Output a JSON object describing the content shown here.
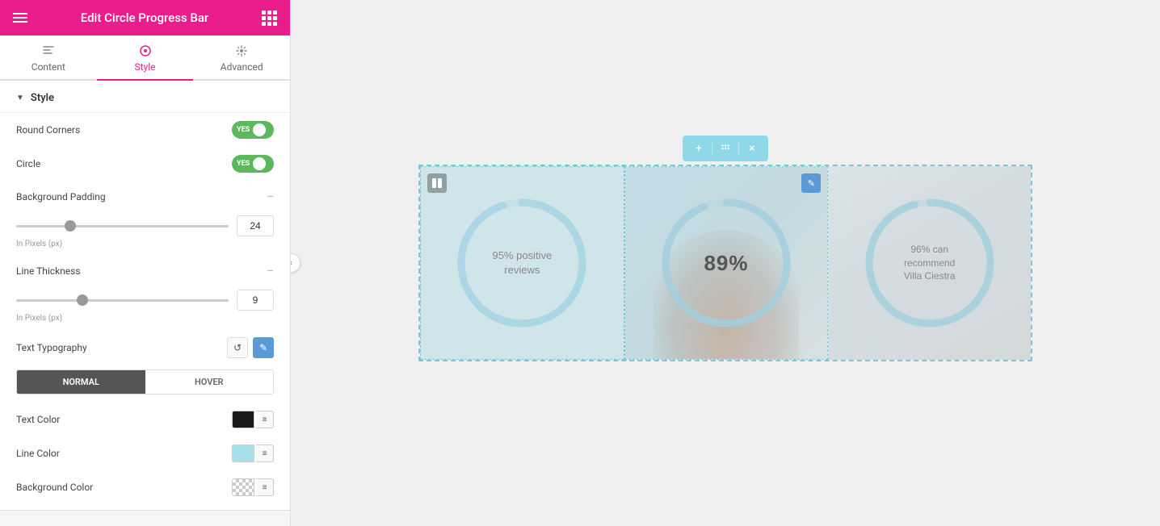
{
  "header": {
    "title": "Edit Circle Progress Bar",
    "hamburger_icon": "hamburger-icon",
    "grid_icon": "grid-icon"
  },
  "tabs": [
    {
      "id": "content",
      "label": "Content",
      "active": false
    },
    {
      "id": "style",
      "label": "Style",
      "active": true
    },
    {
      "id": "advanced",
      "label": "Advanced",
      "active": false
    }
  ],
  "section": {
    "label": "Style"
  },
  "controls": {
    "round_corners": {
      "label": "Round Corners",
      "value": true,
      "toggle_yes": "YES"
    },
    "circle": {
      "label": "Circle",
      "value": true,
      "toggle_yes": "YES"
    },
    "background_padding": {
      "label": "Background Padding",
      "value": 24,
      "unit": "In Pixels (px)"
    },
    "line_thickness": {
      "label": "Line Thickness",
      "value": 9,
      "unit": "In Pixels (px)"
    },
    "text_typography": {
      "label": "Text Typography",
      "reset_icon": "↺",
      "edit_icon": "✎"
    },
    "state_tabs": [
      {
        "id": "normal",
        "label": "NORMAL",
        "active": true
      },
      {
        "id": "hover",
        "label": "HOVER",
        "active": false
      }
    ],
    "text_color": {
      "label": "Text Color",
      "color": "#1a1a1a"
    },
    "line_color": {
      "label": "Line Color",
      "color": "#a8e0e8"
    },
    "background_color": {
      "label": "Background Color",
      "color": "#cccccc"
    }
  },
  "canvas": {
    "float_toolbar": {
      "plus": "+",
      "move": "⠿",
      "close": "×"
    },
    "cells": [
      {
        "id": "cell-1",
        "text": "95% positive\nreviews",
        "text_type": "small",
        "progress": 95,
        "has_edit": false,
        "has_col": true
      },
      {
        "id": "cell-2",
        "text": "89%",
        "text_type": "large",
        "progress": 89,
        "has_edit": true,
        "has_col": false
      },
      {
        "id": "cell-3",
        "text": "96% can\nrecommend\nVilla Ciestra",
        "text_type": "medium",
        "progress": 96,
        "has_edit": false,
        "has_col": false
      }
    ]
  }
}
